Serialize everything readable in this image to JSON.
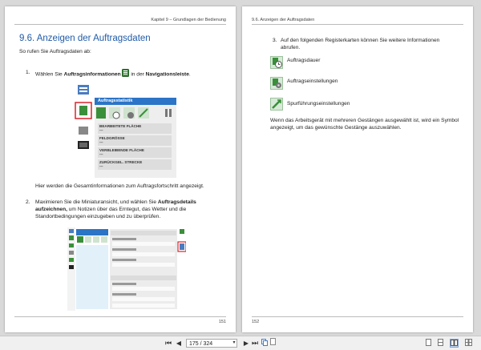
{
  "left": {
    "header": "Kapitel 9 – Grundlagen der Bedienung",
    "title": "9.6. Anzeigen der Auftragsdaten",
    "intro": "So rufen Sie Auftragsdaten ab:",
    "step1_num": "1.",
    "step1_a": "Wählen Sie ",
    "step1_b": "Auftragsinformationen",
    "step1_c": " in der ",
    "step1_d": "Navigationsleiste",
    "step1_e": ".",
    "panel_title": "Auftragsstatistik",
    "panel_rows": [
      "BEARBEITETE FLÄCHE",
      "FELDGRÖSSE",
      "VERBLEIBENDE FLÄCHE",
      "ZURÜCKGEL. STRECKE"
    ],
    "panel_dash": "---",
    "after1": "Hier werden die Gesamtinformationen zum Auftragsfortschritt angezeigt.",
    "step2_num": "2.",
    "step2_a": "Maximieren Sie die Miniaturansicht, und wählen Sie ",
    "step2_b": "Auftragsdetails aufzeichnen,",
    "step2_c": " um Notizen über das Erntegut, das Wetter und die Standortbedingungen einzugeben und zu überprüfen.",
    "page_number": "151"
  },
  "right": {
    "header": "9.6. Anzeigen der Auftragsdaten",
    "step3_num": "3.",
    "step3": "Auf den folgenden Registerkarten können Sie weitere Informationen abrufen.",
    "tabs": [
      {
        "label": "Auftragsdauer",
        "icon": "clock-icon"
      },
      {
        "label": "Auftragseinstellungen",
        "icon": "settings-icon"
      },
      {
        "label": "Spurführungseinstellungen",
        "icon": "guidance-icon"
      }
    ],
    "note": "Wenn das Arbeitsgerät mit mehreren Gestängen ausgewählt ist, wird ein Symbol angezeigt, um das gewünschte Gestänge auszuwählen.",
    "page_number": "152"
  },
  "toolbar": {
    "page_value": "175 / 324",
    "first": "⏮",
    "prev": "◀",
    "next": "▶",
    "last": "⏭"
  },
  "colors": {
    "accent": "#1f5ba8",
    "bar": "#2b74c6",
    "highlight": "#d9242b",
    "green": "#3a8f3a"
  }
}
